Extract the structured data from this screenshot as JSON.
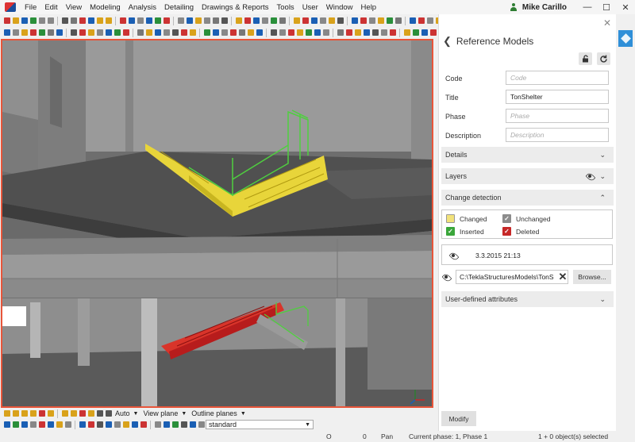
{
  "menubar": {
    "items": [
      "File",
      "Edit",
      "View",
      "Modeling",
      "Analysis",
      "Detailing",
      "Drawings & Reports",
      "Tools",
      "User",
      "Window",
      "Help"
    ],
    "user": "Mike Carillo",
    "window_buttons": [
      "—",
      "☐",
      "✕"
    ]
  },
  "toolbar_row1_colors": [
    "#c33",
    "#d9a21b",
    "#1a5fb4",
    "#2a8f3a",
    "#888",
    "#888",
    "#555",
    "#777",
    "#c33",
    "#1a5fb4",
    "#d9a21b",
    "#d9a21b",
    "#c33",
    "#1a5fb4",
    "#888",
    "#1a5fb4",
    "#2a8f3a",
    "#c33",
    "#888",
    "#1a5fb4",
    "#d9a21b",
    "#888",
    "#777",
    "#555",
    "#d9a21b",
    "#c33",
    "#1a5fb4",
    "#888",
    "#2a8f3a",
    "#777",
    "#d9a21b",
    "#c33",
    "#1a5fb4",
    "#888",
    "#d9a21b",
    "#555",
    "#1a5fb4",
    "#c33",
    "#888",
    "#d9a21b",
    "#2a8f3a",
    "#777",
    "#1a5fb4",
    "#c33",
    "#888",
    "#d9a21b",
    "#555",
    "#1a5fb4",
    "#c33",
    "#888",
    "#d9a21b",
    "#2a8f3a"
  ],
  "toolbar_row2_colors": [
    "#1a5fb4",
    "#888",
    "#d9a21b",
    "#c33",
    "#2a8f3a",
    "#777",
    "#1a5fb4",
    "#555",
    "#c33",
    "#d9a21b",
    "#888",
    "#1a5fb4",
    "#2a8f3a",
    "#c33",
    "#777",
    "#d9a21b",
    "#1a5fb4",
    "#888",
    "#555",
    "#c33",
    "#d9a21b",
    "#2a8f3a",
    "#1a5fb4",
    "#888",
    "#c33",
    "#777",
    "#d9a21b",
    "#1a5fb4",
    "#555",
    "#888",
    "#c33",
    "#d9a21b",
    "#2a8f3a",
    "#1a5fb4",
    "#888",
    "#777",
    "#c33",
    "#d9a21b",
    "#1a5fb4",
    "#555",
    "#888",
    "#c33",
    "#d9a21b",
    "#2a8f3a",
    "#1a5fb4",
    "#c33"
  ],
  "bottom_toolbar1": {
    "icon_colors": [
      "#d9a21b",
      "#d9a21b",
      "#d9a21b",
      "#d9a21b",
      "#c33",
      "#d9a21b",
      "#d9a21b",
      "#d9a21b",
      "#c33",
      "#d9a21b",
      "#555",
      "#555"
    ],
    "dropdowns": [
      "Auto",
      "View plane",
      "Outline planes"
    ]
  },
  "bottom_toolbar2": {
    "icon_colors": [
      "#1a5fb4",
      "#2a8f3a",
      "#1a5fb4",
      "#888",
      "#c33",
      "#1a5fb4",
      "#d9a21b",
      "#888",
      "#1a5fb4",
      "#c33",
      "#555",
      "#1a5fb4",
      "#888",
      "#d9a21b",
      "#1a5fb4",
      "#c33",
      "#888",
      "#1a5fb4",
      "#2a8f3a",
      "#555",
      "#1a5fb4",
      "#888"
    ],
    "selection": "standard"
  },
  "status": {
    "coord_o": "O",
    "coord_zero": "0",
    "mode": "Pan",
    "phase": "Current phase: 1, Phase 1",
    "selected": "1 + 0 object(s) selected"
  },
  "panel": {
    "title": "Reference Models",
    "fields": {
      "code_label": "Code",
      "code_placeholder": "Code",
      "code_value": "",
      "title_label": "Title",
      "title_value": "TonShelter",
      "phase_label": "Phase",
      "phase_placeholder": "Phase",
      "phase_value": "",
      "description_label": "Description",
      "description_placeholder": "Description",
      "description_value": ""
    },
    "sections": {
      "details": "Details",
      "layers": "Layers",
      "change_detection": "Change detection",
      "user_attributes": "User-defined attributes"
    },
    "legend": {
      "changed": "Changed",
      "changed_color": "#f2e27a",
      "unchanged": "Unchanged",
      "unchanged_color": "#8c8c8c",
      "inserted": "Inserted",
      "inserted_color": "#3aa63a",
      "deleted": "Deleted",
      "deleted_color": "#c62828"
    },
    "date": "3.3.2015 21:13",
    "path": "C:\\TeklaStructuresModels\\TonS",
    "browse": "Browse...",
    "modify": "Modify"
  }
}
